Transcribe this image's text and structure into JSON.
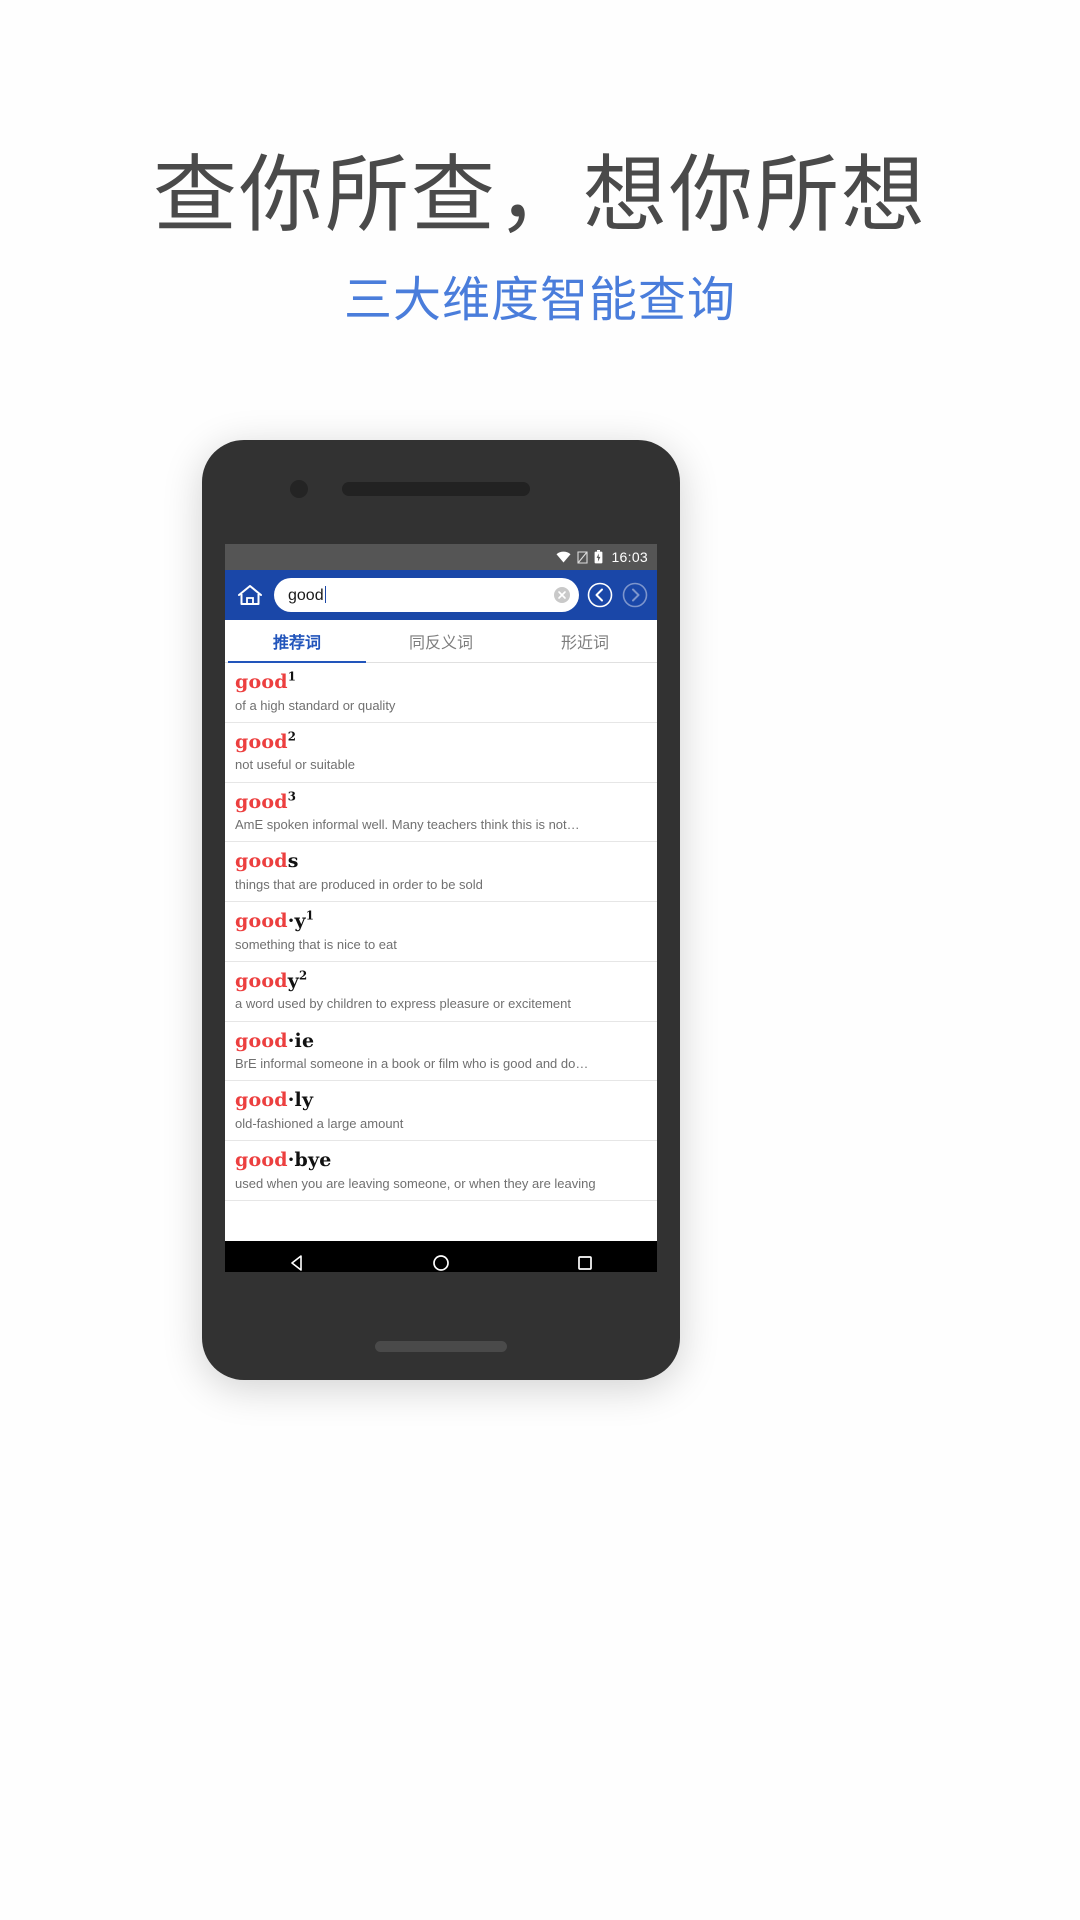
{
  "promo": {
    "headline": "查你所查，想你所想",
    "subtitle": "三大维度智能查询",
    "headline_color": "#4a4a4a",
    "subtitle_color": "#4a7ddb"
  },
  "phone": {
    "statusbar": {
      "time": "16:03",
      "icons": [
        "wifi-icon",
        "sim-icon",
        "battery-icon"
      ]
    },
    "searchbar": {
      "home_icon": "home-icon",
      "query": "good",
      "placeholder": "",
      "clear_icon": "clear-circle-icon",
      "back_icon": "chevron-left-circle-icon",
      "forward_icon": "chevron-right-circle-icon",
      "accent_color": "#1a47a8"
    },
    "tabs": [
      {
        "label": "推荐词",
        "active": true
      },
      {
        "label": "同反义词",
        "active": false
      },
      {
        "label": "形近词",
        "active": false
      }
    ],
    "words": [
      {
        "prefix": "good",
        "suffix": "",
        "sup": "1",
        "def": "of a high standard or quality"
      },
      {
        "prefix": "good",
        "suffix": "",
        "sup": "2",
        "def": "not useful or suitable"
      },
      {
        "prefix": "good",
        "suffix": "",
        "sup": "3",
        "def": "AmE  spoken informal well. Many teachers think this is not…"
      },
      {
        "prefix": "good",
        "suffix": "s",
        "sup": "",
        "def": "things that are produced in order to be sold"
      },
      {
        "prefix": "good",
        "suffix": "·y",
        "sup": "1",
        "def": "something that is nice to eat"
      },
      {
        "prefix": "good",
        "suffix": "y",
        "sup": "2",
        "def": "a word used by children to express pleasure or excitement"
      },
      {
        "prefix": "good",
        "suffix": "·ie",
        "sup": "",
        "def": "BrE  informal someone in a book or film who is good and do…"
      },
      {
        "prefix": "good",
        "suffix": "·ly",
        "sup": "",
        "def": "old-fashioned a large amount"
      },
      {
        "prefix": "good",
        "suffix": "·bye",
        "sup": "",
        "def": "used when you are leaving someone, or when they are leaving"
      }
    ],
    "navbar": {
      "back_icon": "triangle-back-icon",
      "home_icon": "circle-home-icon",
      "recents_icon": "square-recents-icon"
    }
  }
}
